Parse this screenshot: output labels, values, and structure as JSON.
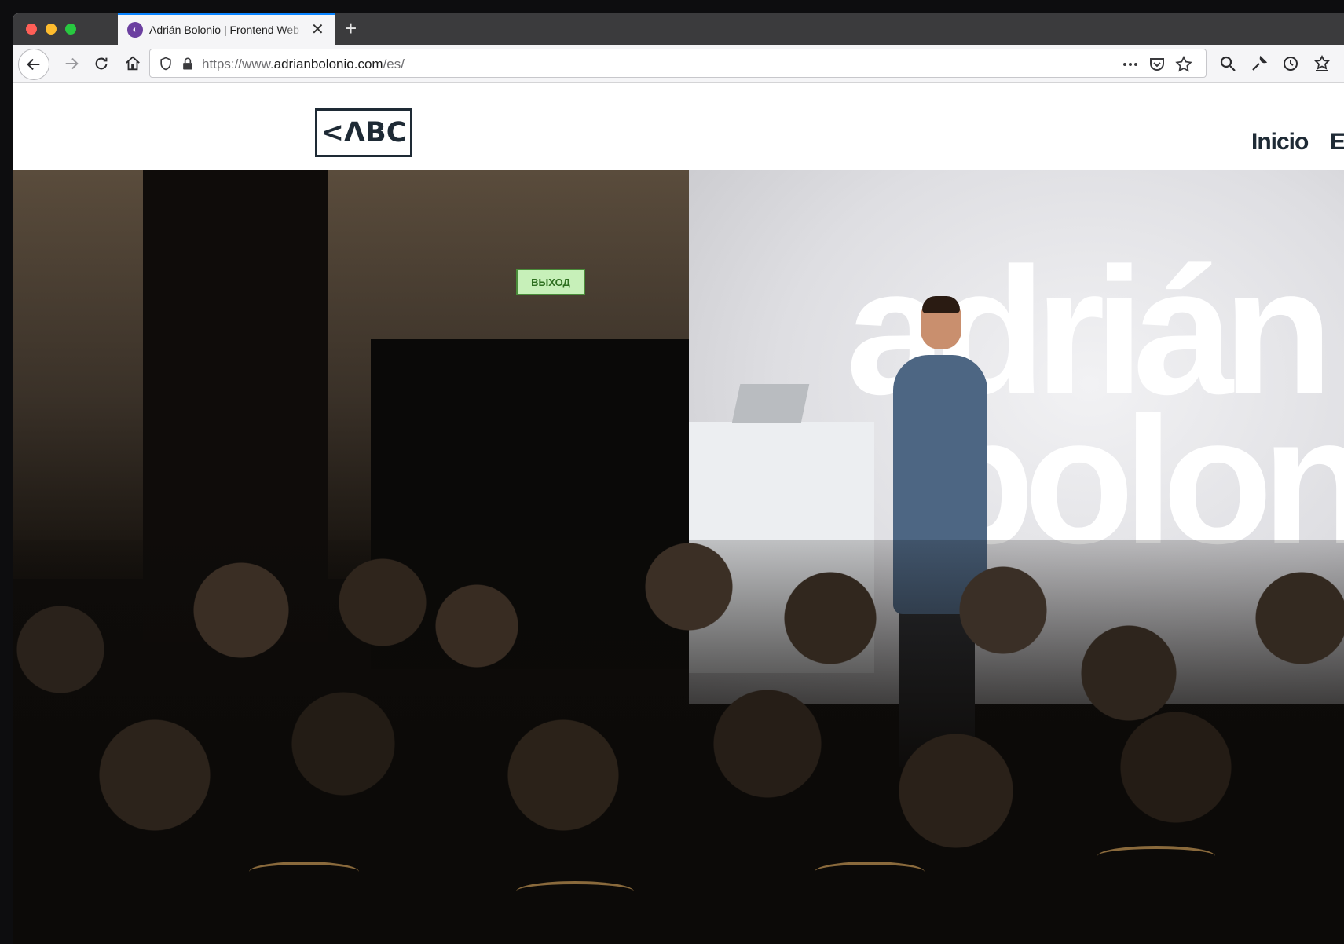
{
  "browser": {
    "tab": {
      "title": "Adrián Bolonio | Frontend Web",
      "favicon": "globe-icon"
    },
    "new_tab_symbol": "+",
    "url": {
      "prefix": "https://www.",
      "domain": "adrianbolonio.com",
      "path": "/es/"
    },
    "toolbar_icons": [
      "back-icon",
      "forward-icon",
      "reload-icon",
      "home-icon",
      "more-icon",
      "pocket-icon",
      "bookmark-star-icon",
      "search-icon",
      "wrench-icon",
      "history-icon",
      "library-icon",
      "extensions-icon"
    ]
  },
  "site": {
    "logo": "<ΛBC",
    "nav": [
      {
        "label": "Inicio"
      },
      {
        "label": "E"
      }
    ]
  },
  "hero": {
    "name_line1": "adrián",
    "name_line2": "bolon",
    "exit_sign": "ВЫХОД"
  },
  "colors": {
    "nav_text": "#1e2a35",
    "tab_accent": "#0a84ff",
    "hero_text": "#ffffff"
  }
}
